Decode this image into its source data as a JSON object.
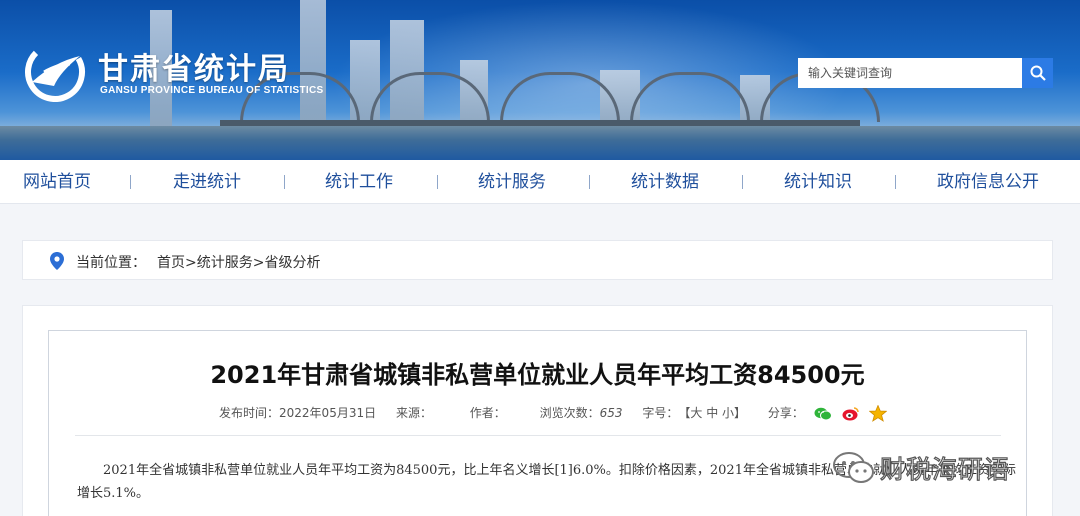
{
  "header": {
    "title": "甘肃省统计局",
    "subtitle": "GANSU PROVINCE BUREAU OF STATISTICS",
    "logo_icon": "gansu-statistics-logo-icon",
    "search": {
      "placeholder": "输入关键词查询",
      "button_icon": "search-icon"
    }
  },
  "nav": {
    "items": [
      {
        "label": "网站首页"
      },
      {
        "label": "走进统计"
      },
      {
        "label": "统计工作"
      },
      {
        "label": "统计服务"
      },
      {
        "label": "统计数据"
      },
      {
        "label": "统计知识"
      },
      {
        "label": "政府信息公开"
      }
    ]
  },
  "breadcrumb": {
    "label": "当前位置：",
    "path": "首页>统计服务>省级分析",
    "icon": "location-pin-icon"
  },
  "article": {
    "title": "2021年甘肃省城镇非私营单位就业人员年平均工资84500元",
    "meta": {
      "date_label": "发布时间：",
      "date": "2022年05月31日",
      "source_label": "来源：",
      "author_label": "作者：",
      "views_label": "浏览次数：",
      "views": "653",
      "font_label": "字号：",
      "font_sizes": "【大 中 小】",
      "share_label": "分享："
    },
    "paragraph": "2021年全省城镇非私营单位就业人员年平均工资为84500元，比上年名义增长[1]6.0%。扣除价格因素，2021年全省城镇非私营单位就业人员年平均工资实际增长5.1%。"
  },
  "watermark": {
    "text": "财税海研语",
    "icon": "wechat-icon"
  },
  "colors": {
    "nav_text": "#1f4f9c",
    "search_button": "#2c7be5",
    "banner_top": "#0b4fa8"
  }
}
